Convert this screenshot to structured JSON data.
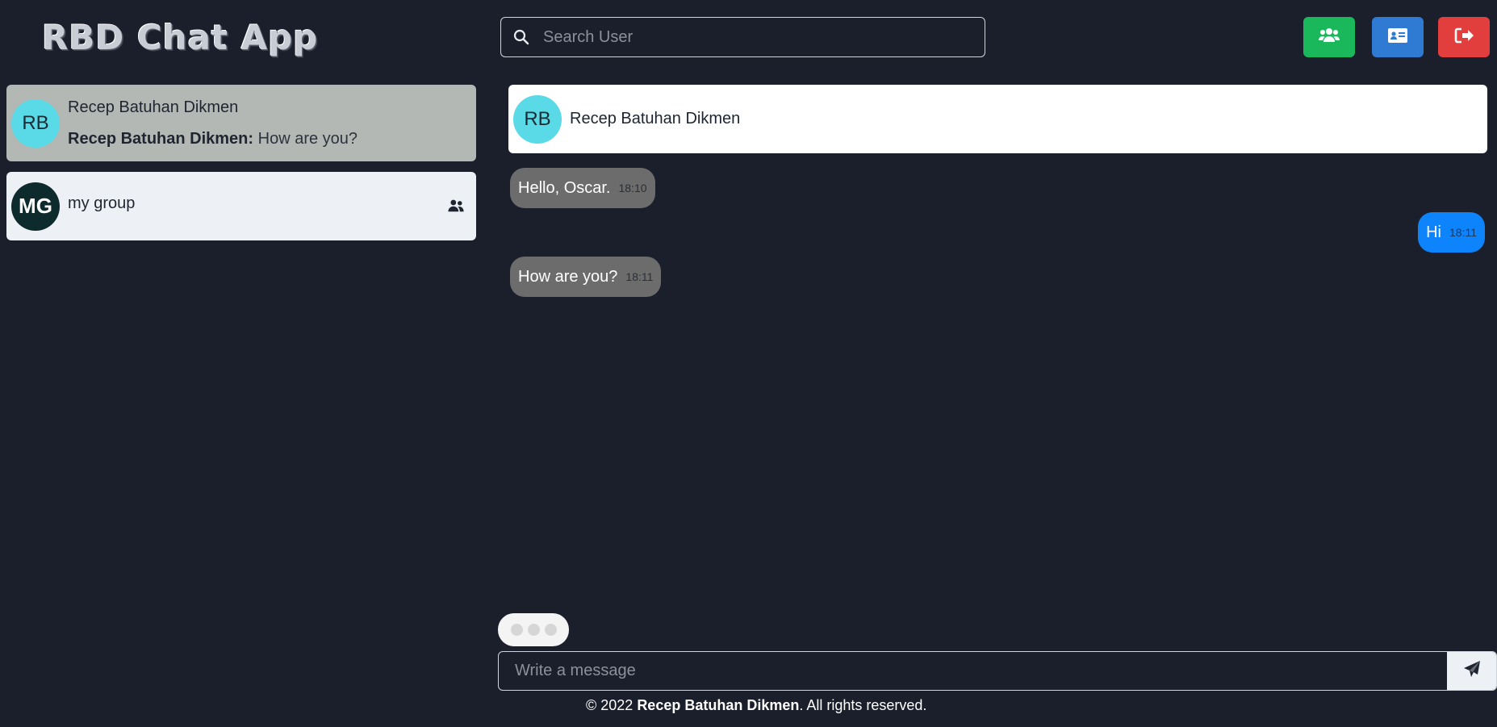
{
  "app": {
    "title": "RBD Chat App"
  },
  "search": {
    "placeholder": "Search User"
  },
  "header_buttons": {
    "groups": {
      "icon": "users-icon",
      "color": "#1ab85a"
    },
    "profile": {
      "icon": "id-card-icon",
      "color": "#2f7bd4"
    },
    "logout": {
      "icon": "sign-out-icon",
      "color": "#e33e3e"
    }
  },
  "sidebar": {
    "chats": [
      {
        "avatar": "RB",
        "name": "Recep Batuhan Dikmen",
        "last_sender": "Recep Batuhan Dikmen:",
        "last_message": "How are you?",
        "active": true
      },
      {
        "avatar": "MG",
        "name": "my group",
        "icon": "users-icon",
        "active": false
      }
    ]
  },
  "chat": {
    "header": {
      "avatar": "RB",
      "name": "Recep Batuhan Dikmen"
    },
    "messages": [
      {
        "direction": "in",
        "text": "Hello, Oscar.",
        "time": "18:10"
      },
      {
        "direction": "out",
        "text": "Hi",
        "time": "18:11"
      },
      {
        "direction": "in",
        "text": "How are you?",
        "time": "18:11"
      }
    ],
    "composer": {
      "placeholder": "Write a message",
      "send_icon": "paper-plane-icon"
    }
  },
  "footer": {
    "prefix": "© 2022 ",
    "author": "Recep Batuhan Dikmen",
    "suffix": ". All rights reserved."
  },
  "colors": {
    "background": "#1b1f2b",
    "active_chat": "#b4b8b4",
    "incoming_bubble": "#6c6c6c",
    "outgoing_bubble": "#0d84fb",
    "avatar_cyan": "#5ad9e6"
  }
}
